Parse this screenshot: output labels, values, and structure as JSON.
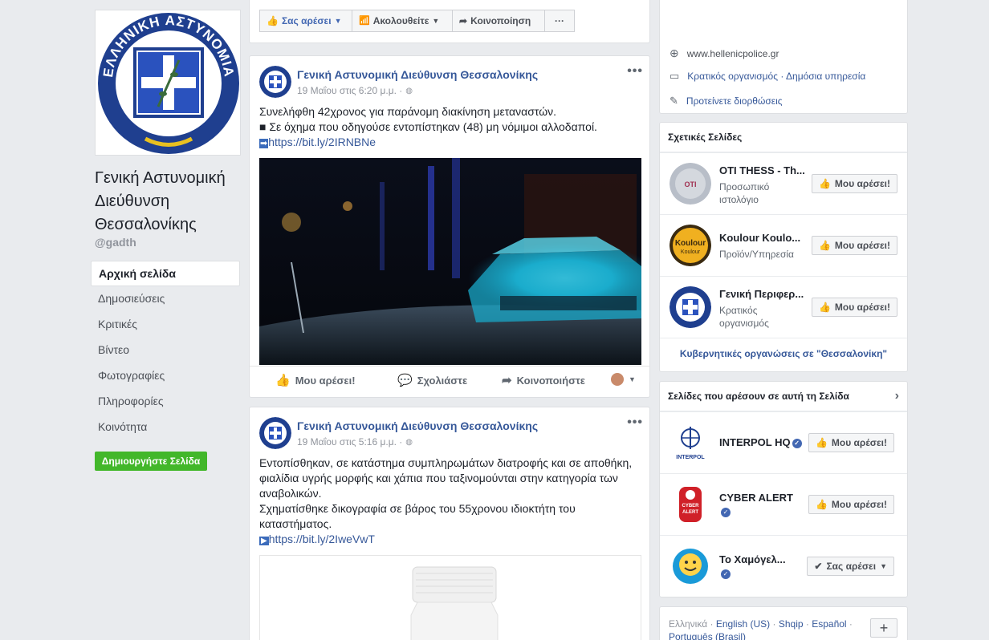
{
  "page": {
    "name": "Γενική Αστυνομική Διεύθυνση Θεσσαλονίκης",
    "handle": "@gadth",
    "logo_text": "ΕΛΛΗΝΙΚΗ ΑΣΤΥΝΟΜΙΑ"
  },
  "nav": {
    "items": [
      "Αρχική σελίδα",
      "Δημοσιεύσεις",
      "Κριτικές",
      "Βίντεο",
      "Φωτογραφίες",
      "Πληροφορίες",
      "Κοινότητα"
    ],
    "create_button": "Δημιουργήστε Σελίδα"
  },
  "action_bar": {
    "like": "Σας αρέσει",
    "follow": "Ακολουθείτε",
    "share": "Κοινοποίηση",
    "more": "···"
  },
  "posts": [
    {
      "author": "Γενική Αστυνομική Διεύθυνση Θεσσαλονίκης",
      "time": "19 Μαΐου στις 6:20 μ.μ. ·",
      "line1": "Συνελήφθη 42χρονος για παράνομη διακίνηση μεταναστών.",
      "line2": "■ Σε όχημα που οδηγούσε εντοπίστηκαν (48) μη νόμιμοι αλλοδαποί.",
      "link_icon": "➡",
      "link": "https://bit.ly/2IRNBNe",
      "actions": {
        "like": "Μου αρέσει!",
        "comment": "Σχολιάστε",
        "share": "Κοινοποιήστε"
      }
    },
    {
      "author": "Γενική Αστυνομική Διεύθυνση Θεσσαλονίκης",
      "time": "19 Μαΐου στις 5:16 μ.μ. ·",
      "line1": "Εντοπίσθηκαν, σε κατάστημα συμπληρωμάτων διατροφής και σε αποθήκη,",
      "line2": "φιαλίδια υγρής μορφής και χάπια που ταξινομούνται στην κατηγορία των",
      "line3": "αναβολικών.",
      "line4": "Σχηματίσθηκε δικογραφία σε βάρος του 55χρονου ιδιοκτήτη του",
      "line5": "καταστήματος.",
      "link_icon": "▶",
      "link": "https://bit.ly/2IweVwT"
    }
  ],
  "info": {
    "website": "www.hellenicpolice.gr",
    "category": "Κρατικός οργανισμός · Δημόσια υπηρεσία",
    "suggest": "Προτείνετε διορθώσεις"
  },
  "related": {
    "header": "Σχετικές Σελίδες",
    "items": [
      {
        "name": "OTI THESS - Th...",
        "sub": "Προσωπικό ιστολόγιο",
        "button": "Μου αρέσει!"
      },
      {
        "name": "Koulour Koulo...",
        "sub": "Προϊόν/Υπηρεσία",
        "button": "Μου αρέσει!"
      },
      {
        "name": "Γενική Περιφερ...",
        "sub": "Κρατικός οργανισμός",
        "button": "Μου αρέσει!"
      }
    ],
    "footer_link": "Κυβερνητικές οργανώσεις σε \"Θεσσαλονίκη\""
  },
  "liked_pages": {
    "header": "Σελίδες που αρέσουν σε αυτή τη Σελίδα",
    "items": [
      {
        "name": "INTERPOL HQ",
        "logo_text": "INTERPOL",
        "button": "Μου αρέσει!"
      },
      {
        "name": "CYBER ALERT",
        "logo_text": "CYBER ALERT",
        "button": "Μου αρέσει!"
      },
      {
        "name": "Το Χαμόγελ...",
        "button": "Σας αρέσει"
      }
    ]
  },
  "footer": {
    "languages": [
      "Ελληνικά",
      "English (US)",
      "Shqip",
      "Español",
      "Português (Brasil)"
    ],
    "plus": "+"
  },
  "colors": {
    "link": "#365899",
    "green": "#42b72a",
    "police_blue": "#1f3f8f"
  }
}
